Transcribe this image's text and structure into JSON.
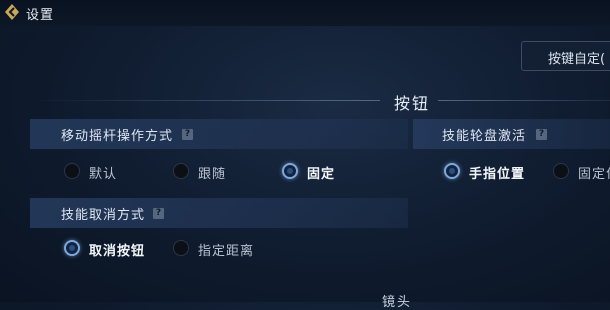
{
  "header": {
    "title": "设置"
  },
  "key_custom_button": "按键自定(",
  "section": {
    "title": "按钮"
  },
  "joystick": {
    "label": "移动摇杆操作方式",
    "help": "?",
    "options": [
      {
        "label": "默认",
        "selected": false
      },
      {
        "label": "跟随",
        "selected": false
      },
      {
        "label": "固定",
        "selected": true
      }
    ]
  },
  "skill_wheel": {
    "label": "技能轮盘激活",
    "help": "?",
    "options": [
      {
        "label": "手指位置",
        "selected": true
      },
      {
        "label": "固定位",
        "selected": false
      }
    ]
  },
  "skill_cancel": {
    "label": "技能取消方式",
    "help": "?",
    "options": [
      {
        "label": "取消按钮",
        "selected": true
      },
      {
        "label": "指定距离",
        "selected": false
      }
    ]
  },
  "next_section_partial": "镜头",
  "colors": {
    "accent": "#7fa7d8",
    "panel": "#263c60",
    "background": "#0f1b2e"
  }
}
